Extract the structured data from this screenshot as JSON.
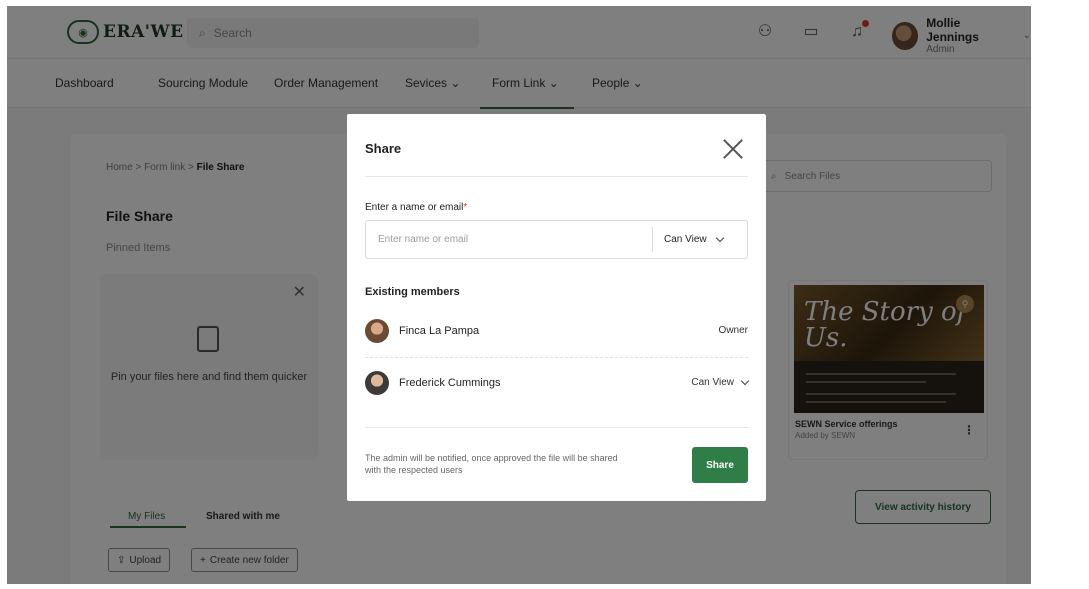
{
  "app": {
    "logo_text": "ERA'WE",
    "search_placeholder": "Search"
  },
  "user": {
    "name": "Mollie Jennings",
    "role": "Admin"
  },
  "nav": {
    "items": [
      "Dashboard",
      "Sourcing Module",
      "Order Management",
      "Sevices",
      "Form Link",
      "People"
    ],
    "active": "Form Link"
  },
  "page": {
    "breadcrumb": [
      "Home",
      "Form link",
      "File Share"
    ],
    "title": "File Share",
    "pinned_label": "Pinned Items",
    "pin_hint": "Pin your files here and find them quicker",
    "search_files_placeholder": "Search Files",
    "story_card": {
      "image_title": "The Story of Us.",
      "name": "SEWN Service offerings",
      "added_by": "Added by SEWN"
    },
    "tabs": [
      "My Files",
      "Shared with me"
    ],
    "active_tab": "My Files",
    "activity_button": "View activity history",
    "upload_button": "Upload",
    "new_folder_button": "Create new folder"
  },
  "modal": {
    "title": "Share",
    "field_label": "Enter a name or email",
    "field_required_mark": "*",
    "field_placeholder": "Enter name or email",
    "field_value": "",
    "permission_value": "Can View",
    "members_heading": "Existing members",
    "members": [
      {
        "name": "Finca La Pampa",
        "role": "Owner"
      },
      {
        "name": "Frederick Cummings",
        "role": "Can View"
      }
    ],
    "note": "The admin will be notified, once approved the file will be shared with the respected users",
    "share_button": "Share"
  },
  "colors": {
    "brand_green": "#2f7d47",
    "required_red": "#d9372b",
    "overlay": "rgba(0,0,0,0.5)"
  }
}
